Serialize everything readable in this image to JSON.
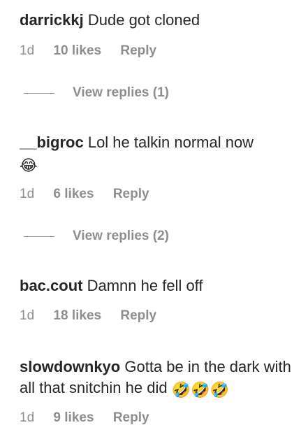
{
  "comments": [
    {
      "username": "darrickkj",
      "text": "Dude got cloned",
      "time": "1d",
      "likes": "10 likes",
      "reply": "Reply",
      "view_replies": "View replies (1)"
    },
    {
      "username": "__bigroc",
      "text": "Lol he talkin normal now",
      "emoji": "😂",
      "time": "1d",
      "likes": "6 likes",
      "reply": "Reply",
      "view_replies": "View replies (2)"
    },
    {
      "username": "bac.cout",
      "text": "Damnn he fell off",
      "time": "1d",
      "likes": "18 likes",
      "reply": "Reply"
    },
    {
      "username": "slowdownkyo",
      "text": "Gotta be in the dark with all that snitchin he did",
      "emoji": "🤣🤣🤣",
      "time": "1d",
      "likes": "9 likes",
      "reply": "Reply"
    }
  ]
}
